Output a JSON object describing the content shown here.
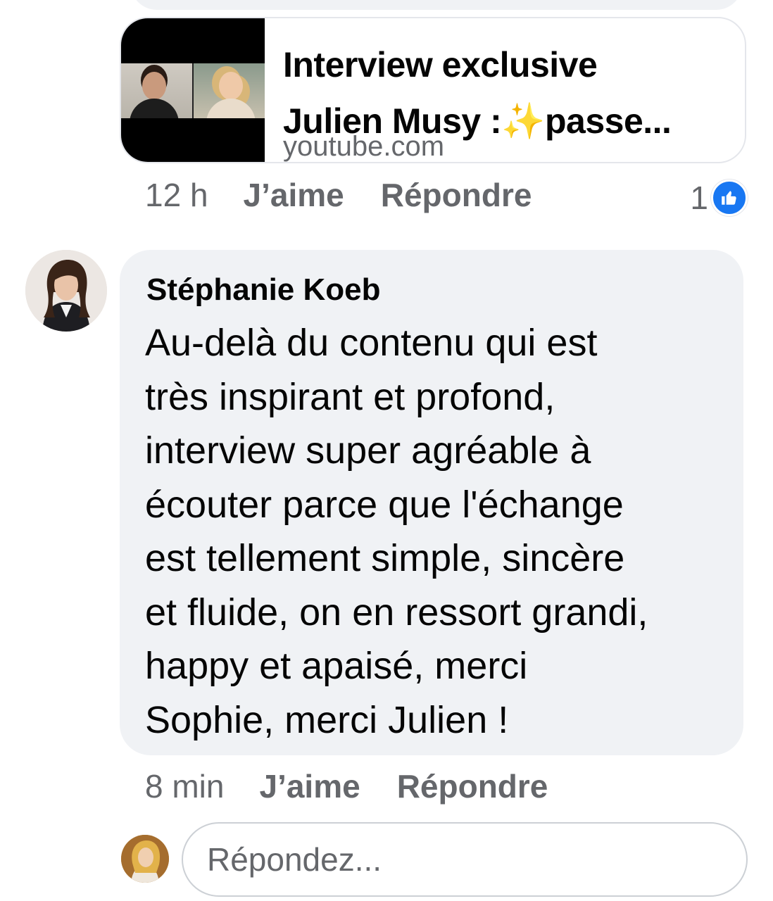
{
  "link_preview": {
    "title_lines": [
      "Interview exclusive",
      "Julien Musy :✨passe..."
    ],
    "domain": "youtube.com"
  },
  "first_comment_actions": {
    "time": "12 h",
    "like_label": "J’aime",
    "reply_label": "Répondre",
    "reaction_count": "1",
    "reaction_icon": "thumbs-up-icon"
  },
  "comment": {
    "author": "Stéphanie Koeb",
    "lines": [
      "Au-delà du contenu qui est",
      "très inspirant et profond,",
      "interview super agréable à",
      "écouter parce que l'échange",
      "est tellement simple, sincère",
      "et fluide, on en ressort grandi,",
      "happy et apaisé, merci",
      "Sophie, merci Julien !"
    ]
  },
  "second_comment_actions": {
    "time": "8 min",
    "like_label": "J’aime",
    "reply_label": "Répondre"
  },
  "reply_box": {
    "placeholder": "Répondez..."
  },
  "colors": {
    "bubble": "#f0f2f5",
    "meta_text": "#65676b",
    "like_blue": "#1877f2"
  }
}
